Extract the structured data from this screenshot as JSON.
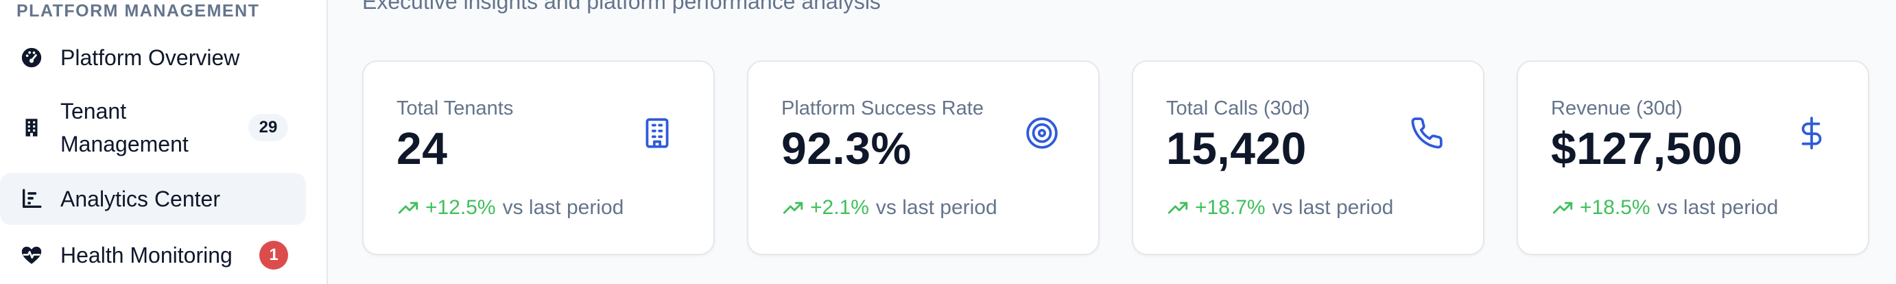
{
  "sidebar": {
    "section_label": "PLATFORM MANAGEMENT",
    "items": [
      {
        "label": "Platform Overview",
        "icon": "gauge-icon"
      },
      {
        "label": "Tenant Management",
        "icon": "building-icon",
        "count": "29"
      },
      {
        "label": "Analytics Center",
        "icon": "bar-chart-icon",
        "active": true
      },
      {
        "label": "Health Monitoring",
        "icon": "heart-pulse-icon",
        "alert": "1"
      }
    ]
  },
  "header": {
    "subtitle": "Executive insights and platform performance analysis"
  },
  "stats": [
    {
      "label": "Total Tenants",
      "value": "24",
      "icon": "building-icon",
      "trend_value": "+12.5%",
      "trend_suffix": "vs last period"
    },
    {
      "label": "Platform Success Rate",
      "value": "92.3%",
      "icon": "target-icon",
      "trend_value": "+2.1%",
      "trend_suffix": "vs last period"
    },
    {
      "label": "Total Calls (30d)",
      "value": "15,420",
      "icon": "phone-icon",
      "trend_value": "+18.7%",
      "trend_suffix": "vs last period"
    },
    {
      "label": "Revenue (30d)",
      "value": "$127,500",
      "icon": "dollar-icon",
      "trend_value": "+18.5%",
      "trend_suffix": "vs last period"
    }
  ],
  "colors": {
    "accent": "#2f5bd8",
    "positive": "#3fbf5a",
    "alert": "#dc4c4c",
    "muted": "#64748b"
  }
}
